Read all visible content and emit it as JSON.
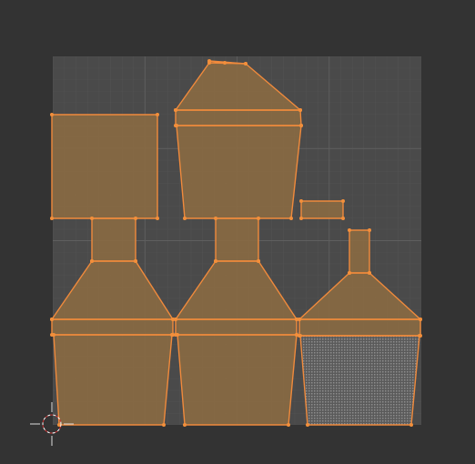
{
  "editor": {
    "background_color": "#333333",
    "uv_space_color": "#4a4a4a",
    "grid_line_color": "#555555",
    "grid_major_color": "#5c5c5c",
    "face_fill_color": "#8a6a42",
    "face_fill_opacity": 0.9,
    "edge_color": "#f08a3c",
    "vertex_color": "#f28f3b",
    "active_face_pattern": "checker-dots",
    "cursor_icon": "2d-cursor-icon"
  },
  "uv_islands": [
    {
      "name": "uv-island-square"
    },
    {
      "name": "uv-island-left-neck"
    },
    {
      "name": "uv-island-left-cone"
    },
    {
      "name": "uv-island-left-ring"
    },
    {
      "name": "uv-island-left-body"
    },
    {
      "name": "uv-island-top-roof"
    },
    {
      "name": "uv-island-top-ring"
    },
    {
      "name": "uv-island-top-body"
    },
    {
      "name": "uv-island-top-tab"
    },
    {
      "name": "uv-island-small-rect"
    },
    {
      "name": "uv-island-middle-neck"
    },
    {
      "name": "uv-island-middle-cone"
    },
    {
      "name": "uv-island-middle-ring"
    },
    {
      "name": "uv-island-middle-body"
    },
    {
      "name": "uv-island-right-neck"
    },
    {
      "name": "uv-island-right-cone"
    },
    {
      "name": "uv-island-right-ring"
    },
    {
      "name": "uv-island-right-body-selected"
    }
  ]
}
